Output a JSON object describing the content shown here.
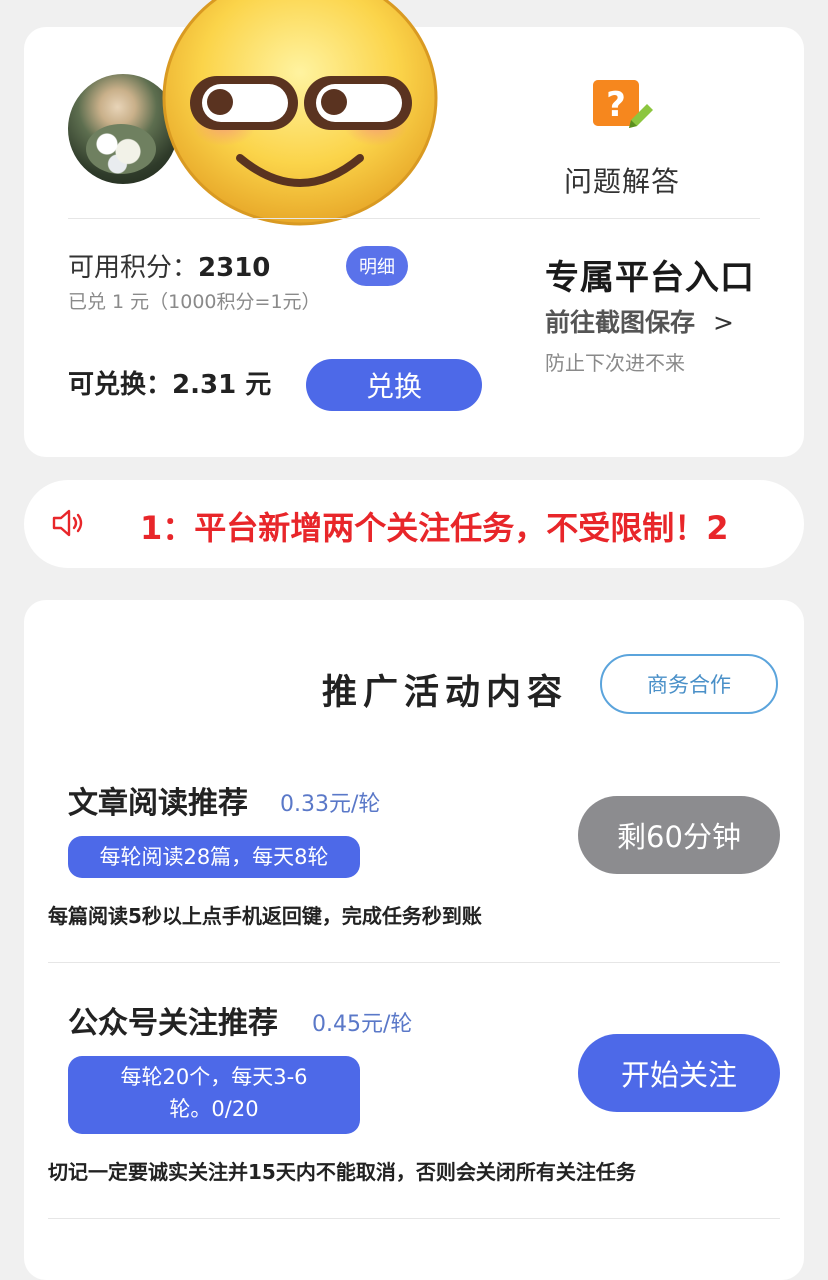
{
  "account": {
    "points_label": "可用积分：",
    "points_value": "2310",
    "detail_button": "明细",
    "redeemed_text": "已兑 1 元（1000积分=1元）",
    "exchangeable_label": "可兑换：",
    "exchangeable_value": "2.31 元",
    "exchange_button": "兑换"
  },
  "help": {
    "label": "问题解答",
    "icon": "question-note-icon"
  },
  "platform": {
    "title": "专属平台入口",
    "link": "前往截图保存",
    "chevron": ">",
    "note": "防止下次进不来"
  },
  "notice": {
    "icon": "speaker-icon",
    "text": "1：平台新增两个关注任务，不受限制！2"
  },
  "promo": {
    "title": "推广活动内容",
    "business_button": "商务合作"
  },
  "tasks": [
    {
      "title": "文章阅读推荐",
      "price": "0.33元/轮",
      "tag": "每轮阅读28篇，每天8轮",
      "description": "每篇阅读5秒以上点手机返回键，完成任务秒到账",
      "button": "剩60分钟",
      "button_color": "#8c8c8f"
    },
    {
      "title": "公众号关注推荐",
      "price": "0.45元/轮",
      "tag_line1": "每轮20个，每天3-6",
      "tag_line2": "轮。0/20",
      "description": "切记一定要诚实关注并15天内不能取消，否则会关闭所有关注任务",
      "button": "开始关注",
      "button_color": "#4d69e8"
    }
  ],
  "colors": {
    "accent": "#4d69e8",
    "notice_red": "#e8262a",
    "background": "#f0f0f0"
  }
}
